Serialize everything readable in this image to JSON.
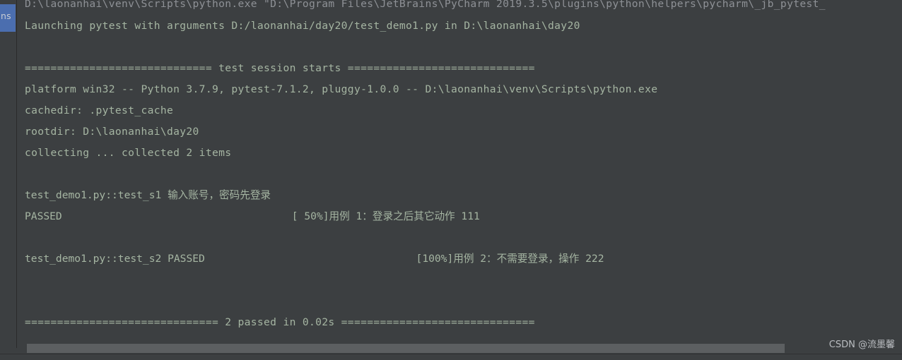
{
  "window": {
    "background_color": "#3c3f41",
    "text_color": "#a5b5a2",
    "accent_color": "#4b6eaf"
  },
  "tool_tab": {
    "label": "ns"
  },
  "console": {
    "lines": [
      {
        "id": "command",
        "text": "D:\\laonanhai\\venv\\Scripts\\python.exe \"D:\\Program Files\\JetBrains\\PyCharm 2019.3.5\\plugins\\python\\helpers\\pycharm\\_jb_pytest_"
      },
      {
        "id": "launching",
        "text": "Launching pytest with arguments D:/laonanhai/day20/test_demo1.py in D:\\laonanhai\\day20"
      },
      {
        "id": "session-header",
        "text": "============================= test session starts ============================="
      },
      {
        "id": "platform",
        "text": "platform win32 -- Python 3.7.9, pytest-7.1.2, pluggy-1.0.0 -- D:\\laonanhai\\venv\\Scripts\\python.exe"
      },
      {
        "id": "cachedir",
        "text": "cachedir: .pytest_cache"
      },
      {
        "id": "rootdir",
        "text": "rootdir: D:\\laonanhai\\day20"
      },
      {
        "id": "collecting",
        "text": "collecting ... collected 2 items"
      },
      {
        "id": "test-s1",
        "text": "test_demo1.py::test_s1 输入账号，密码先登录"
      },
      {
        "id": "test-s1-result",
        "text": "PASSED                                     [ 50%]用例 1：登录之后其它动作 111"
      },
      {
        "id": "test-s2",
        "text": "test_demo1.py::test_s2 PASSED                                  [100%]用例 2：不需要登录，操作 222"
      },
      {
        "id": "summary",
        "text": "============================== 2 passed in 0.02s =============================="
      }
    ]
  },
  "scrollbar": {
    "orientation": "horizontal",
    "thumb_color": "#5c5f61"
  },
  "watermark": {
    "text": "CSDN @流墨馨"
  }
}
